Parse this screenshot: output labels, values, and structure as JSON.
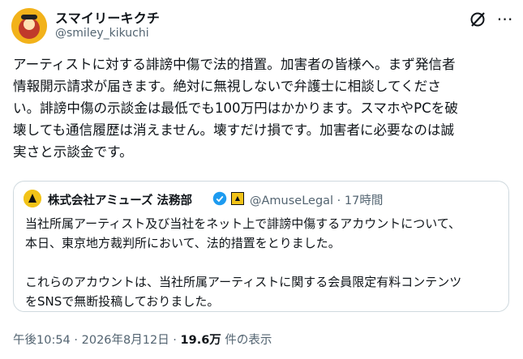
{
  "author": {
    "display_name": "スマイリーキクチ",
    "handle": "@smiley_kikuchi",
    "avatar_icon": "user-avatar-icon"
  },
  "tweet": {
    "text": "アーティストに対する誹謗中傷で法的措置。加害者の皆様へ。まず発信者\n情報開示請求が届きます。絶対に無視しないで弁護士に相談してくださ\nい。誹謗中傷の示談金は最低でも100万円はかかります。スマホやPCを破\n壊しても通信履歴は消えません。壊すだけ損です。加害者に必要なのは誠\n実さと示談金です。"
  },
  "quote": {
    "display_name": "株式会社アミューズ 法務部",
    "handle_time": "@AmuseLegal · 17時間",
    "text": "当社所属アーティスト及び当社をネット上で誹謗中傷するアカウントについて、\n本日、東京地方裁判所において、法的措置をとりました。\n\nこれらのアカウントは、当社所属アーティストに関する会員限定有料コンテンツ\nをSNSで無断投稿しておりました。",
    "verified_icon": "verified-check-icon",
    "badge_icon": "affiliation-badge-icon"
  },
  "footer": {
    "timestamp": "午後10:54 · 2026年8月12日 · ",
    "views": "19.6万",
    "views_suffix": " 件の表示"
  },
  "colors": {
    "secondary_text": "#536471",
    "verified": "#1d9bf0",
    "border": "#cfd9de"
  }
}
